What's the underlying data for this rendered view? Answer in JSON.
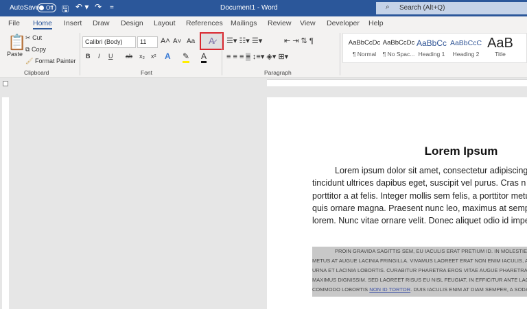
{
  "titlebar": {
    "autosave": "AutoSave",
    "toggle": "Off",
    "doc_title": "Document1 - Word",
    "search": "Search (Alt+Q)"
  },
  "tabs": [
    "File",
    "Home",
    "Insert",
    "Draw",
    "Design",
    "Layout",
    "References",
    "Mailings",
    "Review",
    "View",
    "Developer",
    "Help"
  ],
  "clipboard": {
    "paste": "Paste",
    "cut": "Cut",
    "copy": "Copy",
    "format_painter": "Format Painter",
    "group": "Clipboard"
  },
  "font": {
    "name": "Calibri (Body)",
    "size": "11",
    "case": "Aa",
    "bold": "B",
    "italic": "I",
    "underline": "U",
    "strike": "ab",
    "sub": "x₂",
    "sup": "x²",
    "group": "Font"
  },
  "paragraph": {
    "group": "Paragraph"
  },
  "styles": [
    {
      "preview": "AaBbCcDc",
      "label": "¶ Normal"
    },
    {
      "preview": "AaBbCcDc",
      "label": "¶ No Spac..."
    },
    {
      "preview": "AaBbCc",
      "label": "Heading 1"
    },
    {
      "preview": "AaBbCcC",
      "label": "Heading 2"
    },
    {
      "preview": "AaB",
      "label": "Title"
    }
  ],
  "document": {
    "heading": "Lorem Ipsum",
    "para1": [
      "Lorem ipsum dolor sit amet, consectetur adipiscing",
      "tincidunt ultrices dapibus eget, suscipit vel purus. Cras n",
      "porttitor a at felis. Integer mollis sem felis, a porttitor metus",
      "quis ornare magna. Praesent nunc leo, maximus at semp",
      "lorem. Nunc vitae ornare velit. Donec aliquet odio id imper"
    ],
    "para2": [
      "Proin gravida sagittis sem, eu iaculis erat pretium id. In molestie pha",
      "metus at augue lacinia fringilla. Vivamus laoreet erat non enim iaculis, at po",
      "urna et lacinia lobortis. Curabitur pharetra eros vitae augue pharetra pretium",
      "maximus dignissim. Sed laoreet risus eu nisl feugiat, in efficitur ante lao"
    ],
    "para2_last_a": "commodo lobortis ",
    "para2_link": "non id tortor",
    "para2_last_b": ". Duis iaculis enim at diam semper, a sodales"
  }
}
